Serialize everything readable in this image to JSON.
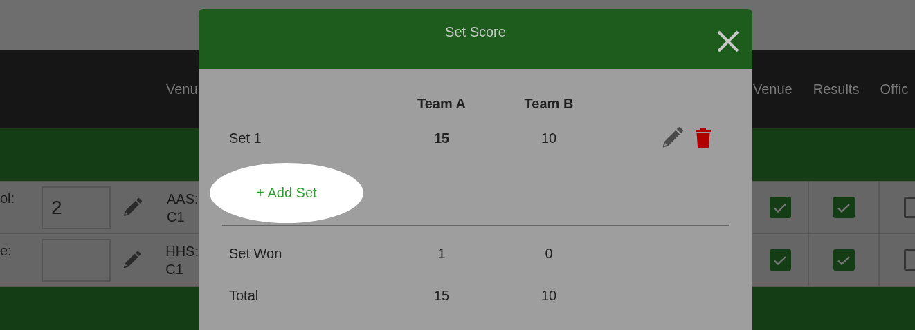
{
  "page": {
    "nav_left": [
      "Venu"
    ],
    "nav_right": [
      "Venue",
      "Results",
      "Offic"
    ],
    "rows": [
      {
        "label": "ol:",
        "input_value": "2",
        "team": "AAS:",
        "court": "C1",
        "checks": [
          {
            "checked": true
          },
          {
            "checked": true
          },
          {
            "checked": false
          }
        ]
      },
      {
        "label": "e:",
        "team": "HHS:",
        "court": "C1",
        "checks": [
          {
            "checked": true
          },
          {
            "checked": true
          },
          {
            "checked": false
          }
        ]
      }
    ]
  },
  "modal": {
    "title": "Set Score",
    "columns": [
      "Team A",
      "Team B"
    ],
    "sets": [
      {
        "label": "Set 1",
        "scores": [
          {
            "value": "15",
            "winner": true
          },
          {
            "value": "10",
            "winner": false
          }
        ]
      }
    ],
    "add_button": {
      "label": "+ Add Set",
      "highlighted": true
    },
    "summary": [
      {
        "label": "Set Won",
        "team_a": "1",
        "team_b": "0"
      },
      {
        "label": "Total",
        "team_a": "15",
        "team_b": "10"
      }
    ]
  }
}
